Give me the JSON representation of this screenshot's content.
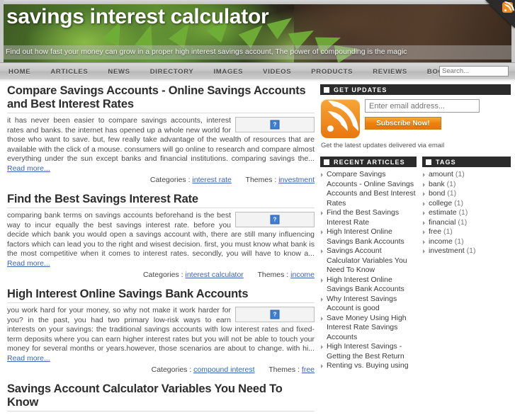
{
  "site": {
    "title": "savings interest calculator",
    "tagline": "Find out how fast your money can grow in a proper high interest savings account, The power of compounding is the magic",
    "rss_icon": "rss-icon"
  },
  "nav": {
    "items": [
      {
        "label": "HOME"
      },
      {
        "label": "ARTICLES"
      },
      {
        "label": "NEWS"
      },
      {
        "label": "DIRECTORY"
      },
      {
        "label": "IMAGES"
      },
      {
        "label": "VIDEOS"
      },
      {
        "label": "PRODUCTS"
      },
      {
        "label": "REVIEWS"
      },
      {
        "label": "BOOKS"
      }
    ],
    "search_placeholder": "Search..."
  },
  "articles": [
    {
      "title": "Compare Savings Accounts - Online Savings Accounts and Best Interest Rates",
      "excerpt": "it has never been easier to compare savings accounts, interest rates and banks. the internet has opened up a whole new world for those who want to save. but, few really take advantage of the wealth of resources that are available with the click of a mouse. consumers will go online to research and compare almost everything under the sun except banks and financial institutions. comparing savings the...",
      "read_more": "Read more...",
      "categories_label": "Categories :",
      "category": "interest rate",
      "themes_label": "Themes :",
      "theme": "investment",
      "thumb_alt": "?"
    },
    {
      "title": "Find the Best Savings Interest Rate",
      "excerpt": "comparing bank terms on savings accounts beforehand is the best way to incur equally the best savings interest rate. before you decide which bank you would open a savings account with, there are still many influencing factors which can lead you to the right and wisest decision. first, you must know what bank is the most competitive when it comes to interest rates. secondly, you will have to know a...",
      "read_more": "Read more...",
      "categories_label": "Categories :",
      "category": "interest calculator",
      "themes_label": "Themes :",
      "theme": "income",
      "thumb_alt": "?"
    },
    {
      "title": "High Interest Online Savings Bank Accounts",
      "excerpt": "you work hard for your money, so why not make it work harder for you? in the past, you had two primary low-risk ways to earn interests on your savings: the traditional savings accounts with low interest rates and fixed-term deposits where you can earn higher interest rates but you will not be able to touch your money for several months or years.however, those scenarios are about to change. with hi...",
      "read_more": "Read more...",
      "categories_label": "Categories :",
      "category": "compound interest",
      "themes_label": "Themes :",
      "theme": "free",
      "thumb_alt": "?"
    },
    {
      "title": "Savings Account Calculator Variables You Need To Know",
      "excerpt": "",
      "read_more": "",
      "categories_label": "",
      "category": "",
      "themes_label": "",
      "theme": "",
      "thumb_alt": "?"
    }
  ],
  "sidebar": {
    "updates": {
      "heading": "GET UPDATES",
      "email_placeholder": "Enter email address...",
      "subscribe_label": "Subscribe Now!",
      "note": "Get the latest updates delivered via email",
      "rss_icon": "rss-icon"
    },
    "recent": {
      "heading": "RECENT ARTICLES",
      "items": [
        {
          "label": "Compare Savings Accounts - Online Savings Accounts and Best Interest Rates"
        },
        {
          "label": "Find the Best Savings Interest Rate"
        },
        {
          "label": "High Interest Online Savings Bank Accounts"
        },
        {
          "label": "Savings Account Calculator Variables You Need To Know"
        },
        {
          "label": "High Interest Online Savings Bank Accounts"
        },
        {
          "label": "Why Interest Savings Account is good"
        },
        {
          "label": "Save Money Using High Interest Rate Savings Accounts"
        },
        {
          "label": "High Interest Savings - Getting the Best Return"
        },
        {
          "label": "Renting vs. Buying using"
        }
      ]
    },
    "tags": {
      "heading": "TAGS",
      "items": [
        {
          "label": "amount",
          "count": "(1)"
        },
        {
          "label": "bank",
          "count": "(1)"
        },
        {
          "label": "bond",
          "count": "(1)"
        },
        {
          "label": "college",
          "count": "(1)"
        },
        {
          "label": "estimate",
          "count": "(1)"
        },
        {
          "label": "financial",
          "count": "(1)"
        },
        {
          "label": "free",
          "count": "(1)"
        },
        {
          "label": "income",
          "count": "(1)"
        },
        {
          "label": "investment",
          "count": "(1)"
        }
      ]
    }
  },
  "colors": {
    "accent_orange": "#ef8209",
    "link_blue": "#3c62b5",
    "widget_header_bg": "#2b2b2b"
  }
}
